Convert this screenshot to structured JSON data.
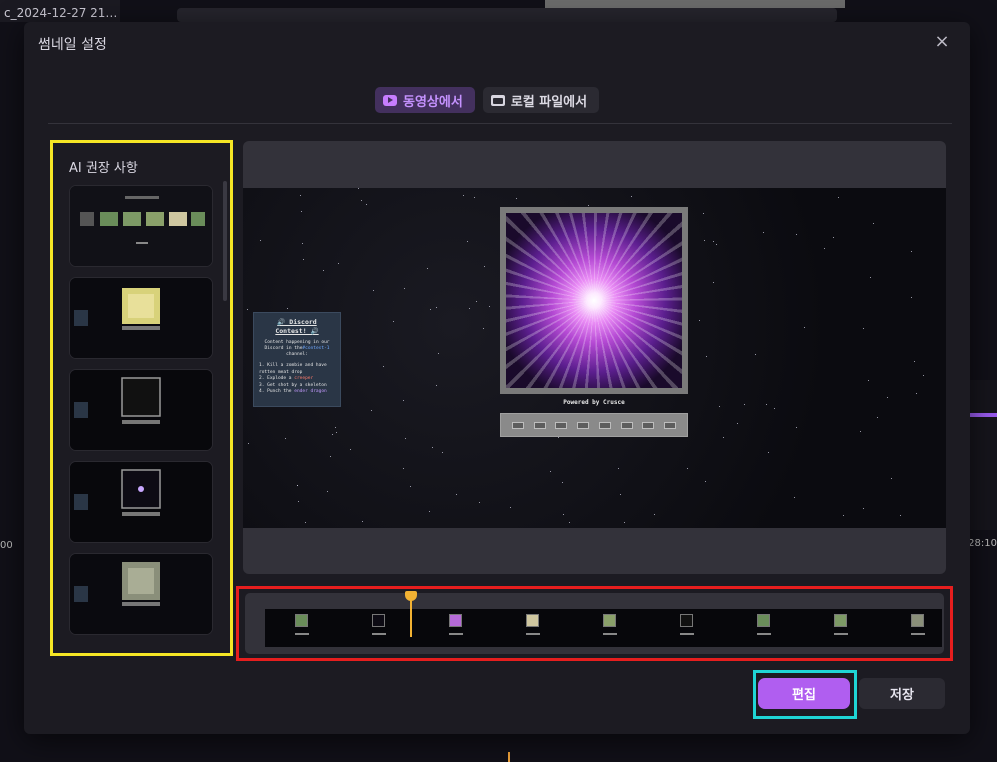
{
  "background": {
    "tab_title": "c_2024-12-27 21…",
    "left_time": "00",
    "right_time": "28:10"
  },
  "dialog": {
    "title": "썸네일 설정",
    "close_icon": "close-icon"
  },
  "tabs": [
    {
      "label": "동영상에서",
      "icon": "youtube-icon",
      "active": true
    },
    {
      "label": "로컬 파일에서",
      "icon": "folder-icon",
      "active": false
    }
  ],
  "sidebar": {
    "label": "AI 권장 사항",
    "thumbnails": 5
  },
  "preview": {
    "powered_by": "Powered by Crusce",
    "card": {
      "title_line1": "🔊 Discord",
      "title_line2": "Contest! 🔊",
      "body_1": "Content happening in our",
      "body_2": "Discord in the",
      "body_channel": "#contest-1",
      "body_3": "channel:",
      "item_1": "1. Kill a zombie and have",
      "item_1b": "rotten meat drop",
      "item_2_pre": "2. Explode a ",
      "item_2_hl": "creeper",
      "item_3": "3. Get shot by a skeleton",
      "item_4_pre": "4. Punch the ",
      "item_4_hl": "ender dragon"
    }
  },
  "buttons": {
    "edit": "편집",
    "save": "저장"
  },
  "colors": {
    "accent": "#b05ef0",
    "tab_active_text": "#c592ff",
    "playhead": "#f2b233",
    "sidebar_highlight": "#f5e625",
    "strip_highlight": "#e61e1e",
    "edit_highlight": "#1fd5d5"
  }
}
